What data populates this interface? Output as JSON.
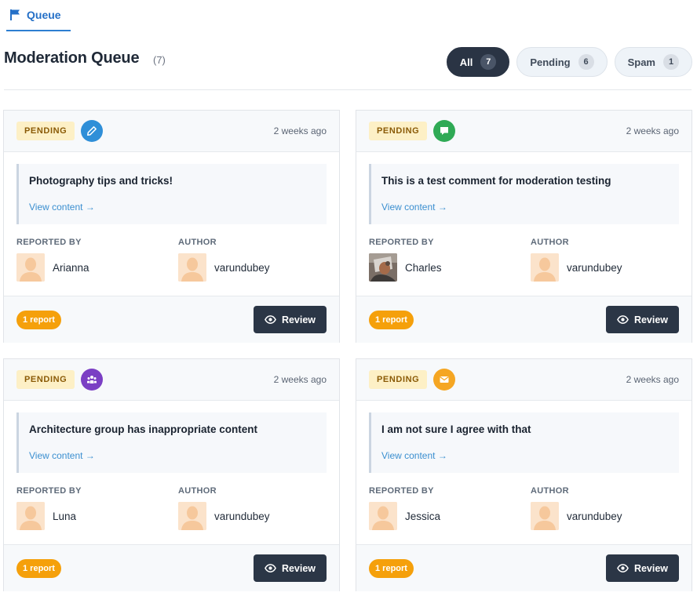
{
  "tabs": [
    {
      "label": "Queue",
      "icon": "flag-icon",
      "active": true
    }
  ],
  "header": {
    "title": "Moderation Queue",
    "count": "(7)"
  },
  "filters": [
    {
      "label": "All",
      "count": "7",
      "active": true
    },
    {
      "label": "Pending",
      "count": "6",
      "active": false
    },
    {
      "label": "Spam",
      "count": "1",
      "active": false
    }
  ],
  "labels": {
    "reported_by": "REPORTED BY",
    "author": "AUTHOR",
    "view_content": "View content →",
    "review": "Review"
  },
  "colors": {
    "accent": "#2570c7",
    "pending_bg": "#fdf0c6",
    "report_badge": "#f5a00b",
    "review_button": "#2b3646"
  },
  "cards": [
    {
      "status": "PENDING",
      "type_icon": "pencil-icon",
      "type_color": "#2f8fd8",
      "time": "2 weeks ago",
      "title": "Photography tips and tricks!",
      "reporter": {
        "name": "Arianna",
        "avatar": "default-avatar"
      },
      "author": {
        "name": "varundubey",
        "avatar": "default-avatar"
      },
      "reports": "1 report"
    },
    {
      "status": "PENDING",
      "type_icon": "comment-icon",
      "type_color": "#2faa55",
      "time": "2 weeks ago",
      "title": "This is a test comment for moderation testing",
      "reporter": {
        "name": "Charles",
        "avatar": "photo-avatar"
      },
      "author": {
        "name": "varundubey",
        "avatar": "default-avatar"
      },
      "reports": "1 report"
    },
    {
      "status": "PENDING",
      "type_icon": "group-icon",
      "type_color": "#7b3fc4",
      "time": "2 weeks ago",
      "title": "Architecture group has inappropriate content",
      "reporter": {
        "name": "Luna",
        "avatar": "default-avatar"
      },
      "author": {
        "name": "varundubey",
        "avatar": "default-avatar"
      },
      "reports": "1 report"
    },
    {
      "status": "PENDING",
      "type_icon": "envelope-icon",
      "type_color": "#f5a623",
      "time": "2 weeks ago",
      "title": "I am not sure I agree with that",
      "reporter": {
        "name": "Jessica",
        "avatar": "default-avatar"
      },
      "author": {
        "name": "varundubey",
        "avatar": "default-avatar"
      },
      "reports": "1 report"
    }
  ]
}
